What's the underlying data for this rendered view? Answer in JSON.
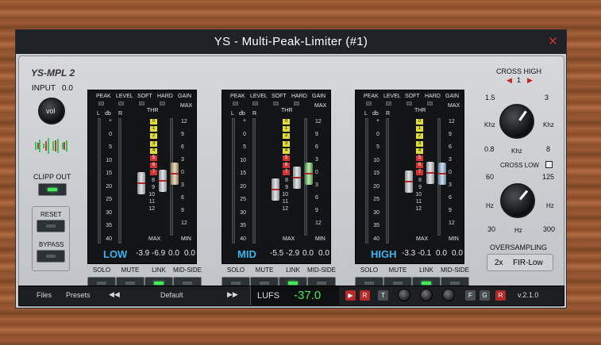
{
  "window": {
    "title": "YS - Multi-Peak-Limiter (#1)",
    "close": "✕"
  },
  "left": {
    "logo": "YS-MPL 2",
    "input_label": "INPUT",
    "input_value": "0.0",
    "knob_label": "vol",
    "clip_out": "CLIPP OUT",
    "reset": "RESET",
    "bypass": "BYPASS"
  },
  "headers": {
    "peak": "PEAK",
    "level": "LEVEL",
    "soft": "SOFT",
    "hard": "HARD",
    "gain": "GAIN",
    "thr": "THR",
    "max": "MAX",
    "min": "MIN",
    "l": "L",
    "db": "db",
    "r": "R"
  },
  "meter_scale": [
    "+",
    "0",
    "5",
    "10",
    "15",
    "20",
    "25",
    "30",
    "35",
    "40"
  ],
  "gain_scale": [
    "12",
    "9",
    "6",
    "3",
    "0",
    "3",
    "6",
    "9",
    "12"
  ],
  "thr_scale": [
    "0",
    "1",
    "2",
    "3",
    "4",
    "5",
    "6",
    "7",
    "8",
    "9",
    "10",
    "11",
    "12"
  ],
  "bands": [
    {
      "name": "LOW",
      "thr": "-3.9",
      "hard": "-6.9",
      "gain": "0.0",
      "gain2": "0.0"
    },
    {
      "name": "MID",
      "thr": "-5.5",
      "hard": "-2.9",
      "gain": "0.0",
      "gain2": "0.0"
    },
    {
      "name": "HIGH",
      "thr": "-3.3",
      "hard": "-0.1",
      "gain": "0.0",
      "gain2": "0.0"
    }
  ],
  "band_buttons": {
    "solo": "SOLO",
    "mute": "MUTE",
    "link": "LINK",
    "midside": "MID-SIDE"
  },
  "cross_high": {
    "label": "CROSS HIGH",
    "value": "1",
    "left_arrow": "◀",
    "right_arrow": "▶",
    "min1": "1.5",
    "max1": "3",
    "unit": "Khz",
    "min2": "0.8",
    "max2": "8",
    "knob_unit": "Khz"
  },
  "cross_low": {
    "label": "CROSS LOW",
    "min1": "60",
    "max1": "125",
    "unit": "Hz",
    "min2": "30",
    "max2": "300",
    "knob_unit": "Hz"
  },
  "oversampling": {
    "label": "OVERSAMPLING",
    "factor": "2x",
    "mode": "FIR-Low"
  },
  "footer": {
    "files": "Files",
    "presets": "Presets",
    "prev": "◀◀",
    "preset_name": "Default",
    "next": "▶▶",
    "lufs_label": "LUFS",
    "lufs_value": "-37.0",
    "play": "▶",
    "r1": "R",
    "t": "T",
    "f": "F",
    "g": "G",
    "r2": "R",
    "version": "v.2.1.0"
  },
  "colors": {
    "accent_blue": "#3ab4f0",
    "lufs_green": "#46e85a",
    "led_green": "#46e85a",
    "red": "#d43333"
  }
}
